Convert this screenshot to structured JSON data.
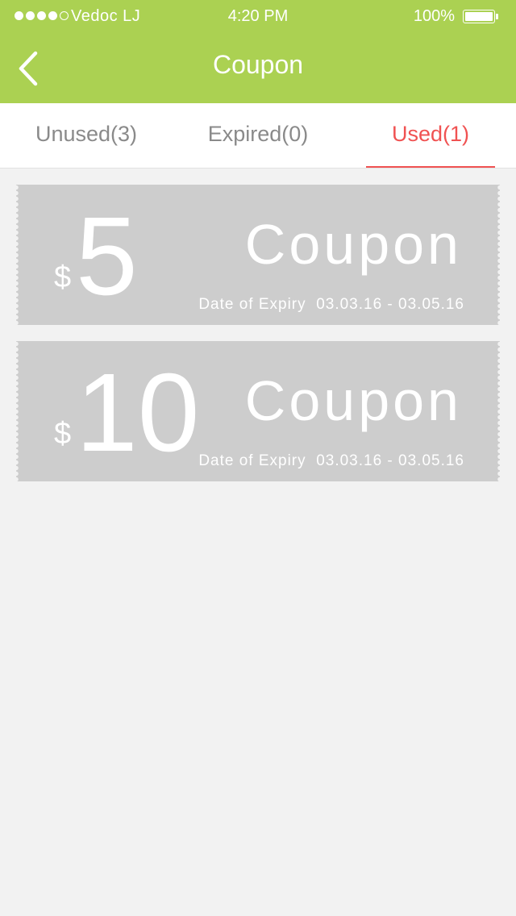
{
  "status_bar": {
    "carrier": "Vedoc LJ",
    "time": "4:20 PM",
    "battery": "100%"
  },
  "header": {
    "title": "Coupon",
    "back_icon": "chevron-left-icon"
  },
  "tabs": [
    {
      "label": "Unused(3)",
      "active": false
    },
    {
      "label": "Expired(0)",
      "active": false
    },
    {
      "label": "Used(1)",
      "active": true
    }
  ],
  "coupons": [
    {
      "currency": "$",
      "amount": "5",
      "label": "Coupon",
      "expiry": "Date of Expiry  03.03.16 - 03.05.16"
    },
    {
      "currency": "$",
      "amount": "10",
      "label": "Coupon",
      "expiry": "Date of Expiry  03.03.16 - 03.05.16"
    }
  ],
  "colors": {
    "header_bg": "#abd152",
    "active_tab": "#f05252",
    "coupon_bg": "#cdcdcd",
    "page_bg": "#f2f2f2"
  }
}
